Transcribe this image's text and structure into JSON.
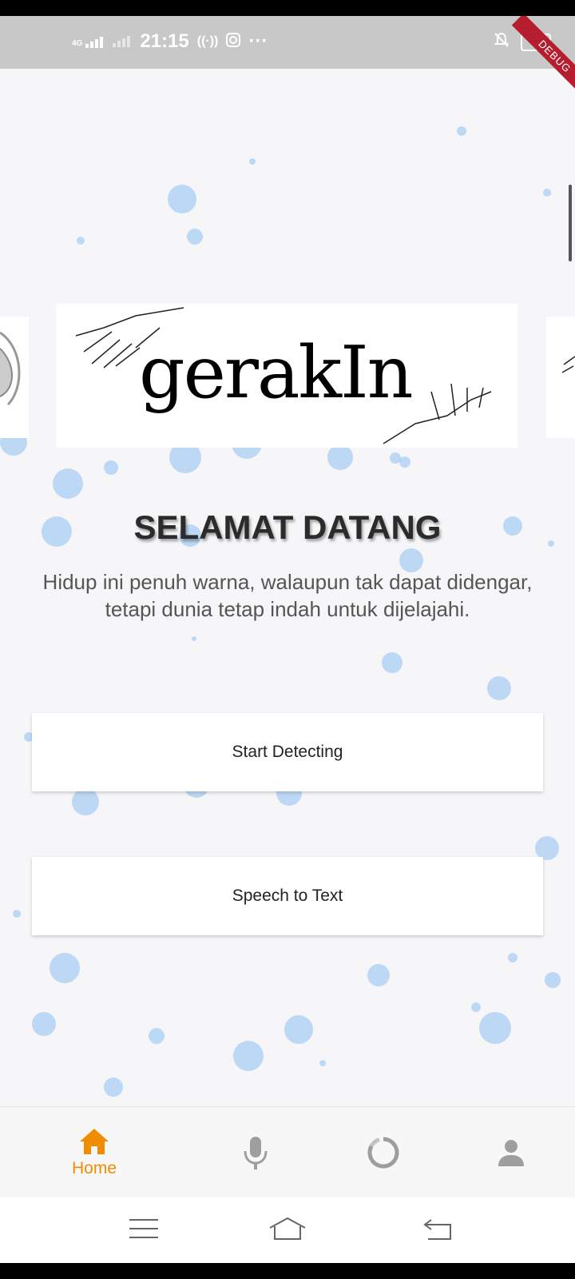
{
  "status_bar": {
    "network": "4G",
    "time": "21:15",
    "battery": "68",
    "debug_label": "DEBUG"
  },
  "banner": {
    "logo_text": "gerakIn"
  },
  "welcome": {
    "title": "SELAMAT DATANG",
    "line1": "Hidup ini penuh warna, walaupun tak dapat didengar,",
    "line2": "tetapi dunia tetap indah untuk dijelajahi."
  },
  "buttons": {
    "start_detecting": "Start Detecting",
    "speech_to_text": "Speech to Text"
  },
  "bottom_nav": {
    "items": [
      {
        "label": "Home",
        "icon": "home-icon",
        "active": true
      },
      {
        "label": "",
        "icon": "mic-icon",
        "active": false
      },
      {
        "label": "",
        "icon": "progress-icon",
        "active": false
      },
      {
        "label": "",
        "icon": "person-icon",
        "active": false
      }
    ],
    "active_color": "#f08c00",
    "inactive_color": "#9e9e9e"
  },
  "system_nav": {
    "icons": [
      "menu-icon",
      "home-outline-icon",
      "back-icon"
    ]
  },
  "colors": {
    "bubble": "#78b4f0",
    "background": "#f6f6f8"
  }
}
